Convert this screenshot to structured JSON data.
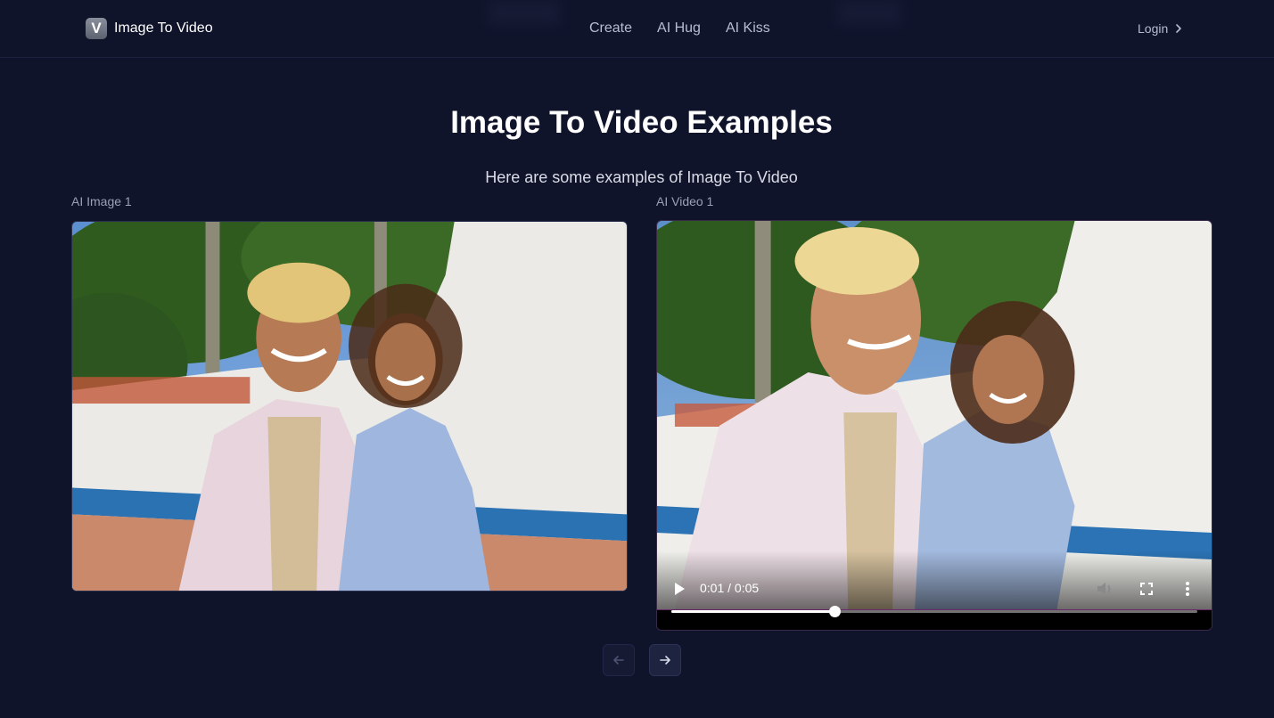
{
  "brand": {
    "logo_letter": "V",
    "name": "Image To Video"
  },
  "nav": {
    "items": [
      "Create",
      "AI Hug",
      "AI Kiss"
    ]
  },
  "login": {
    "label": "Login"
  },
  "hero": {
    "title": "Image To Video Examples",
    "subtitle": "Here are some examples of Image To Video"
  },
  "examples": {
    "image_label": "AI Image 1",
    "video_label": "AI Video 1"
  },
  "video": {
    "time_display": "0:01 / 0:05",
    "progress": 0.31,
    "accent": "#ffffff"
  },
  "pager": {
    "prev_icon": "arrow-left-icon",
    "next_icon": "arrow-right-icon"
  },
  "colors": {
    "background": "#10142b",
    "text": "#e5e7eb",
    "muted": "#9aa0b6"
  }
}
